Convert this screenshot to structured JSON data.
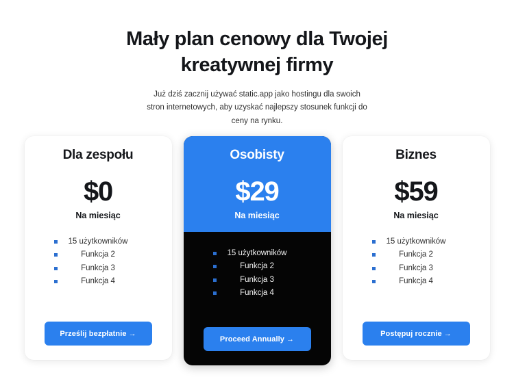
{
  "header": {
    "headline": "Mały plan cenowy dla Twojej kreatywnej firmy",
    "subhead": "Już dziś zacznij używać static.app jako hostingu dla swoich stron internetowych, aby uzyskać najlepszy stosunek funkcji do ceny na rynku."
  },
  "colors": {
    "accent_blue": "#2b80ee",
    "featured_dark": "#050505",
    "bullet_blue": "#2b6fd0",
    "page_background": "#ffffff",
    "heading_text": "#14161a"
  },
  "plans": [
    {
      "name": "Dla zespołu",
      "price": "$0",
      "period": "Na miesiąc",
      "features": [
        "15 użytkowników",
        "Funkcja 2",
        "Funkcja 3",
        "Funkcja 4"
      ],
      "cta_label": "Prześlij bezpłatnie",
      "cta_arrow": "→",
      "featured": false
    },
    {
      "name": "Osobisty",
      "price": "$29",
      "period": "Na miesiąc",
      "features": [
        "15 użytkowników",
        "Funkcja 2",
        "Funkcja 3",
        "Funkcja 4"
      ],
      "cta_label": "Proceed Annually",
      "cta_arrow": "→",
      "featured": true
    },
    {
      "name": "Biznes",
      "price": "$59",
      "period": "Na miesiąc",
      "features": [
        "15 użytkowników",
        "Funkcja 2",
        "Funkcja 3",
        "Funkcja 4"
      ],
      "cta_label": "Postępuj rocznie",
      "cta_arrow": "→",
      "featured": false
    }
  ]
}
